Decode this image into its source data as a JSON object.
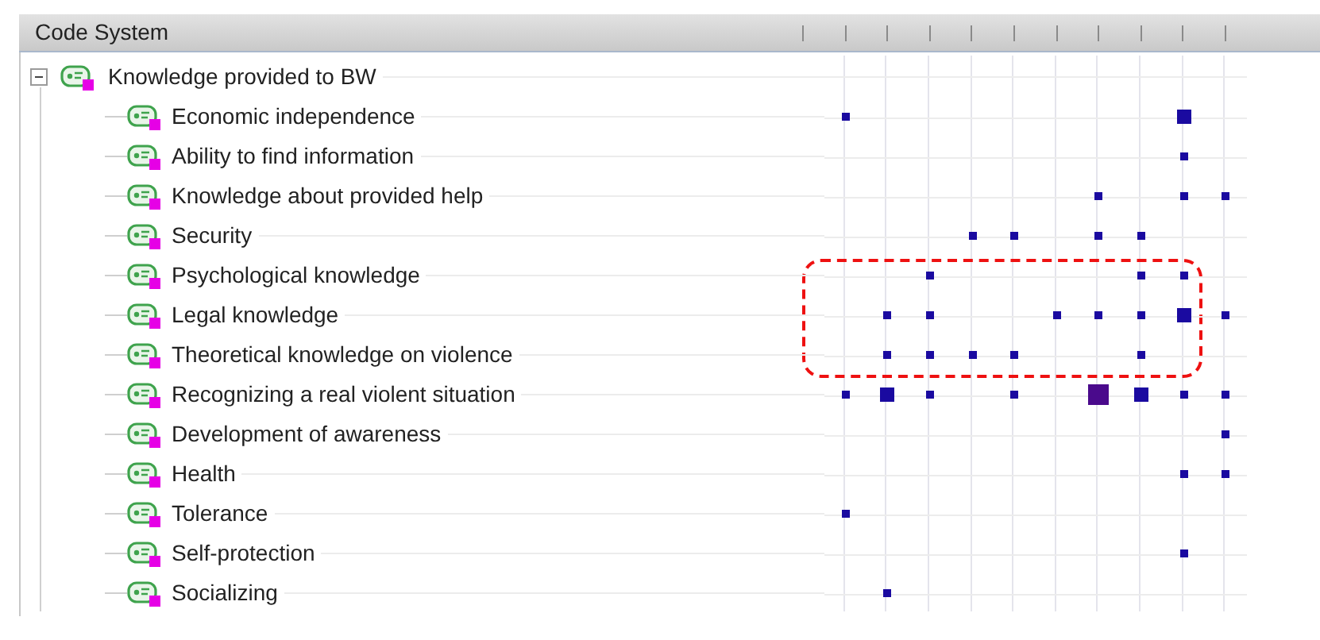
{
  "header": {
    "title": "Code System"
  },
  "root": {
    "label": "Knowledge provided to BW",
    "expanded": true,
    "children": [
      {
        "label": "Economic independence",
        "cells": [
          {
            "kind": "small"
          },
          {
            "kind": "empty"
          },
          {
            "kind": "empty"
          },
          {
            "kind": "empty"
          },
          {
            "kind": "empty"
          },
          {
            "kind": "empty"
          },
          {
            "kind": "empty"
          },
          {
            "kind": "empty"
          },
          {
            "kind": "medium"
          },
          {
            "kind": "empty"
          }
        ]
      },
      {
        "label": "Ability to find information",
        "cells": [
          {
            "kind": "empty"
          },
          {
            "kind": "empty"
          },
          {
            "kind": "empty"
          },
          {
            "kind": "empty"
          },
          {
            "kind": "empty"
          },
          {
            "kind": "empty"
          },
          {
            "kind": "empty"
          },
          {
            "kind": "empty"
          },
          {
            "kind": "small"
          },
          {
            "kind": "empty"
          }
        ]
      },
      {
        "label": "Knowledge about provided help",
        "cells": [
          {
            "kind": "empty"
          },
          {
            "kind": "empty"
          },
          {
            "kind": "empty"
          },
          {
            "kind": "empty"
          },
          {
            "kind": "empty"
          },
          {
            "kind": "empty"
          },
          {
            "kind": "small"
          },
          {
            "kind": "empty"
          },
          {
            "kind": "small"
          },
          {
            "kind": "small"
          }
        ]
      },
      {
        "label": "Security",
        "cells": [
          {
            "kind": "empty"
          },
          {
            "kind": "empty"
          },
          {
            "kind": "empty"
          },
          {
            "kind": "small"
          },
          {
            "kind": "small"
          },
          {
            "kind": "empty"
          },
          {
            "kind": "small"
          },
          {
            "kind": "small"
          },
          {
            "kind": "empty"
          },
          {
            "kind": "empty"
          }
        ]
      },
      {
        "label": "Psychological knowledge",
        "cells": [
          {
            "kind": "empty"
          },
          {
            "kind": "empty"
          },
          {
            "kind": "small"
          },
          {
            "kind": "empty"
          },
          {
            "kind": "empty"
          },
          {
            "kind": "empty"
          },
          {
            "kind": "empty"
          },
          {
            "kind": "small"
          },
          {
            "kind": "small"
          },
          {
            "kind": "empty"
          }
        ]
      },
      {
        "label": "Legal knowledge",
        "cells": [
          {
            "kind": "empty"
          },
          {
            "kind": "small"
          },
          {
            "kind": "small"
          },
          {
            "kind": "empty"
          },
          {
            "kind": "empty"
          },
          {
            "kind": "small"
          },
          {
            "kind": "small"
          },
          {
            "kind": "small"
          },
          {
            "kind": "medium"
          },
          {
            "kind": "small"
          }
        ]
      },
      {
        "label": "Theoretical knowledge on violence",
        "cells": [
          {
            "kind": "empty"
          },
          {
            "kind": "small"
          },
          {
            "kind": "small"
          },
          {
            "kind": "small"
          },
          {
            "kind": "small"
          },
          {
            "kind": "empty"
          },
          {
            "kind": "empty"
          },
          {
            "kind": "small"
          },
          {
            "kind": "empty"
          },
          {
            "kind": "empty"
          }
        ]
      },
      {
        "label": "Recognizing a real violent situation",
        "cells": [
          {
            "kind": "small"
          },
          {
            "kind": "medium"
          },
          {
            "kind": "small"
          },
          {
            "kind": "empty"
          },
          {
            "kind": "small"
          },
          {
            "kind": "empty"
          },
          {
            "kind": "large"
          },
          {
            "kind": "medium"
          },
          {
            "kind": "small"
          },
          {
            "kind": "small"
          }
        ]
      },
      {
        "label": "Development of awareness",
        "cells": [
          {
            "kind": "empty"
          },
          {
            "kind": "empty"
          },
          {
            "kind": "empty"
          },
          {
            "kind": "empty"
          },
          {
            "kind": "empty"
          },
          {
            "kind": "empty"
          },
          {
            "kind": "empty"
          },
          {
            "kind": "empty"
          },
          {
            "kind": "empty"
          },
          {
            "kind": "small"
          }
        ]
      },
      {
        "label": "Health",
        "cells": [
          {
            "kind": "empty"
          },
          {
            "kind": "empty"
          },
          {
            "kind": "empty"
          },
          {
            "kind": "empty"
          },
          {
            "kind": "empty"
          },
          {
            "kind": "empty"
          },
          {
            "kind": "empty"
          },
          {
            "kind": "empty"
          },
          {
            "kind": "small"
          },
          {
            "kind": "small"
          }
        ]
      },
      {
        "label": "Tolerance",
        "cells": [
          {
            "kind": "small"
          },
          {
            "kind": "empty"
          },
          {
            "kind": "empty"
          },
          {
            "kind": "empty"
          },
          {
            "kind": "empty"
          },
          {
            "kind": "empty"
          },
          {
            "kind": "empty"
          },
          {
            "kind": "empty"
          },
          {
            "kind": "empty"
          },
          {
            "kind": "empty"
          }
        ]
      },
      {
        "label": "Self-protection",
        "cells": [
          {
            "kind": "empty"
          },
          {
            "kind": "empty"
          },
          {
            "kind": "empty"
          },
          {
            "kind": "empty"
          },
          {
            "kind": "empty"
          },
          {
            "kind": "empty"
          },
          {
            "kind": "empty"
          },
          {
            "kind": "empty"
          },
          {
            "kind": "small"
          },
          {
            "kind": "empty"
          }
        ]
      },
      {
        "label": "Socializing",
        "cells": [
          {
            "kind": "empty"
          },
          {
            "kind": "small"
          },
          {
            "kind": "empty"
          },
          {
            "kind": "empty"
          },
          {
            "kind": "empty"
          },
          {
            "kind": "empty"
          },
          {
            "kind": "empty"
          },
          {
            "kind": "empty"
          },
          {
            "kind": "empty"
          },
          {
            "kind": "empty"
          }
        ]
      }
    ]
  }
}
